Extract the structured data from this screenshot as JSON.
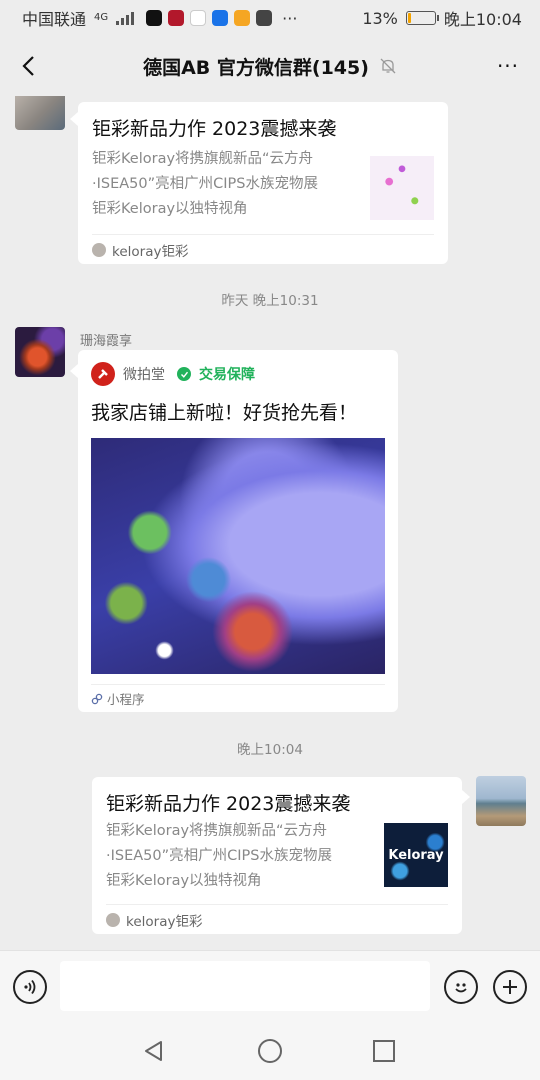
{
  "status_bar": {
    "carrier": "中国联通",
    "network": "4G",
    "battery_percent": "13%",
    "time": "晚上10:04",
    "more": "···",
    "battery_level": 0.13,
    "battery_color": "#f4a300"
  },
  "header": {
    "back_icon": "chevron-left-icon",
    "title": "德国AB 官方微信群(145)",
    "mute_icon": "bell-off-icon",
    "more_label": "···"
  },
  "messages": [
    {
      "type": "link_card",
      "side": "left",
      "title": "钜彩新品力作 2023震撼来袭",
      "description": [
        "钜彩Keloray将携旗舰新品“云方舟",
        "·ISEA50”亮相广州CIPS水族宠物展",
        "钜彩Keloray以独特视角"
      ],
      "source": "keloray钜彩"
    },
    {
      "type": "timestamp",
      "text": "昨天 晚上10:31"
    },
    {
      "type": "mini_program",
      "side": "left",
      "sender": "珊海霞享",
      "app_name": "微拍堂",
      "badge": "交易保障",
      "badge_color": "#21b25b",
      "title": "我家店铺上新啦！好货抢先看！",
      "footer": "小程序"
    },
    {
      "type": "timestamp",
      "text": "晚上10:04"
    },
    {
      "type": "link_card",
      "side": "right",
      "title": "钜彩新品力作 2023震撼来袭",
      "description": [
        "钜彩Keloray将携旗舰新品“云方舟",
        "·ISEA50”亮相广州CIPS水族宠物展",
        "钜彩Keloray以独特视角"
      ],
      "source": "keloray钜彩",
      "thumb_text": "Keloray"
    }
  ],
  "input_bar": {
    "voice_icon": "voice-icon",
    "emoji_icon": "emoji-icon",
    "plus_icon": "plus-icon",
    "placeholder": ""
  },
  "nav_bar": {
    "back_icon": "triangle-back-icon",
    "home_icon": "circle-home-icon",
    "recents_icon": "square-recents-icon"
  }
}
